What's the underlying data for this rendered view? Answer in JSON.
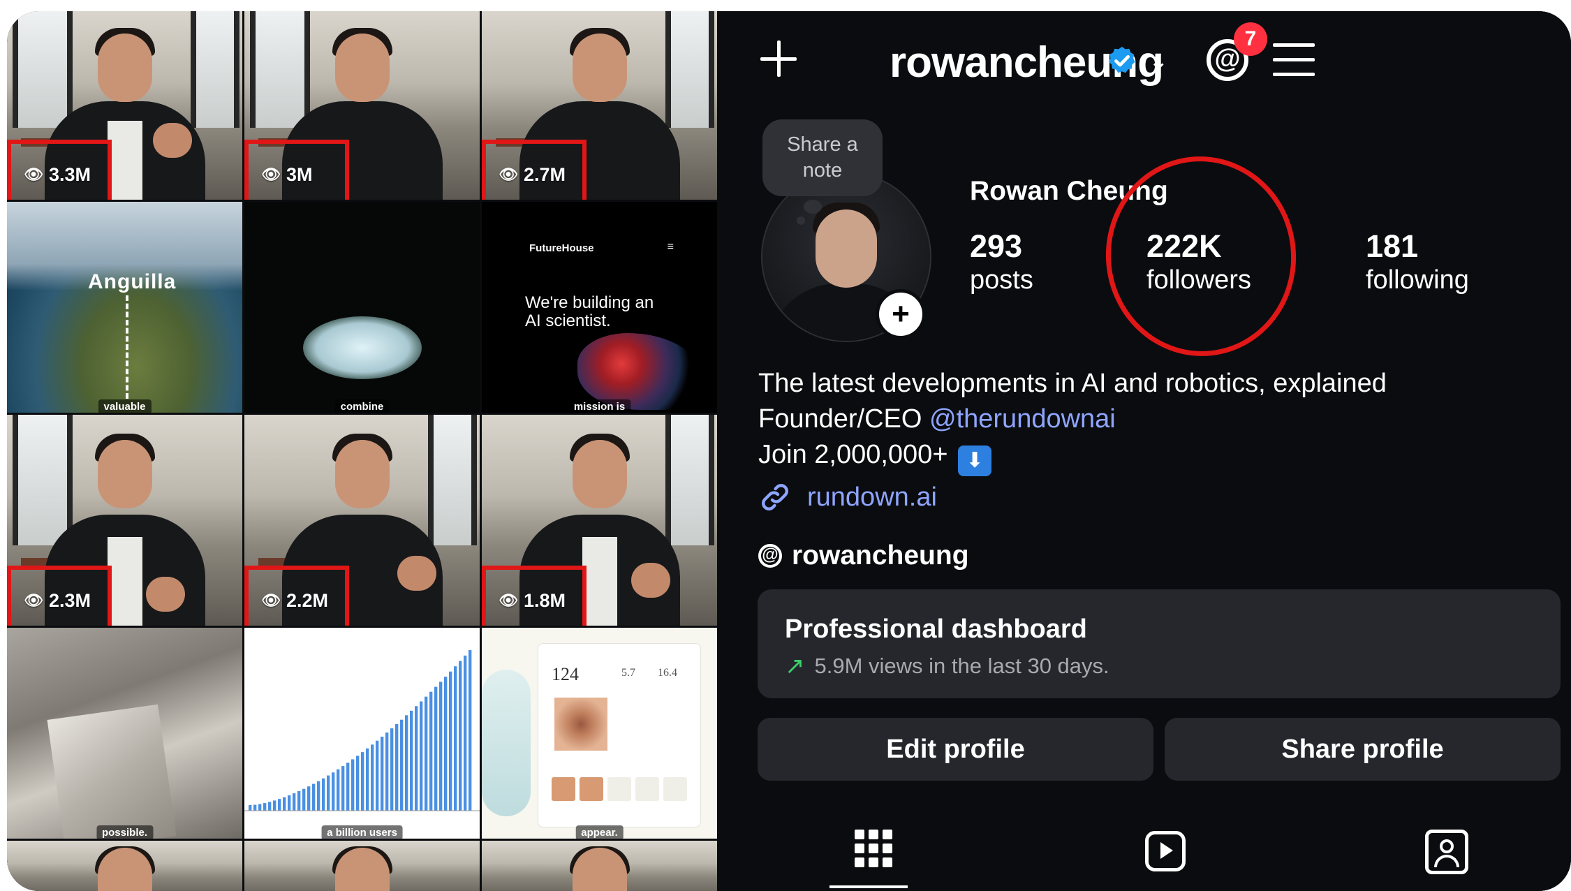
{
  "header": {
    "username": "rowancheung",
    "notification_count": "7"
  },
  "note": {
    "text": "Share a note"
  },
  "profile": {
    "full_name": "Rowan Cheung",
    "stats": [
      {
        "value": "293",
        "label": "posts"
      },
      {
        "value": "222K",
        "label": "followers"
      },
      {
        "value": "181",
        "label": "following"
      }
    ],
    "bio_line1": "The latest developments in AI and robotics, explained",
    "bio_line2_prefix": "Founder/CEO ",
    "bio_mention": "@therundownai",
    "bio_line3": "Join 2,000,000+",
    "website": "rundown.ai",
    "threads_handle": "rowancheung"
  },
  "dashboard": {
    "title": "Professional dashboard",
    "subtitle": "5.9M views in the last 30 days."
  },
  "buttons": {
    "edit": "Edit profile",
    "share": "Share profile"
  },
  "grid": {
    "views": [
      "3.3M",
      "3M",
      "2.7M",
      "2.3M",
      "2.2M",
      "1.8M"
    ],
    "captions": [
      "valuable",
      "combine",
      "mission is",
      "possible.",
      "a billion users",
      "appear."
    ],
    "map_label": "Anguilla",
    "futurehouse_brand": "FutureHouse",
    "futurehouse_headline": "We're building an AI scientist.",
    "app_number": "124",
    "app_small1": "5.7",
    "app_small2": "16.4"
  },
  "colors": {
    "highlight_red": "#e11616",
    "link_blue": "#8ea5ff",
    "verified_blue": "#1d9bf0",
    "badge_red": "#ff3040",
    "trend_green": "#3ccf6b"
  },
  "icons": [
    "create-plus-icon",
    "verified-badge-icon",
    "chevron-down-icon",
    "threads-icon",
    "menu-icon",
    "link-icon",
    "grid-icon",
    "reels-icon",
    "tagged-icon",
    "eye-icon"
  ]
}
